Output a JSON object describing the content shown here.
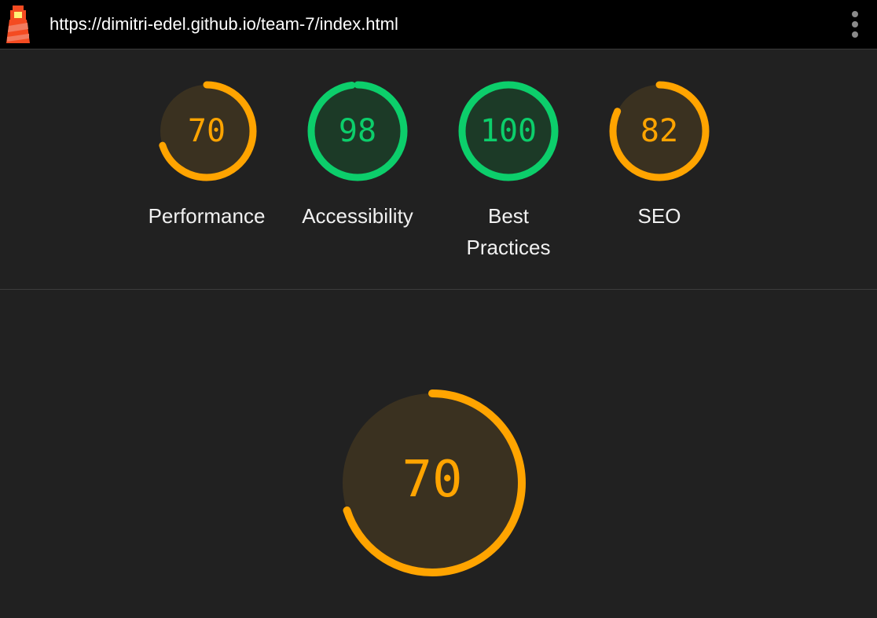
{
  "header": {
    "url": "https://dimitri-edel.github.io/team-7/index.html",
    "logo_icon": "lighthouse-icon",
    "menu_icon": "more-vert-icon"
  },
  "colors": {
    "average": "#ffa400",
    "pass": "#0cce6b",
    "average_bg": "#3a3120",
    "pass_bg": "#1c3a27"
  },
  "gauges": [
    {
      "label": "Performance",
      "score": 70,
      "rating": "average"
    },
    {
      "label": "Accessibility",
      "score": 98,
      "rating": "pass"
    },
    {
      "label": "Best Practices",
      "score": 100,
      "rating": "pass"
    },
    {
      "label": "SEO",
      "score": 82,
      "rating": "average"
    }
  ],
  "main_gauge": {
    "score": 70,
    "rating": "average"
  }
}
